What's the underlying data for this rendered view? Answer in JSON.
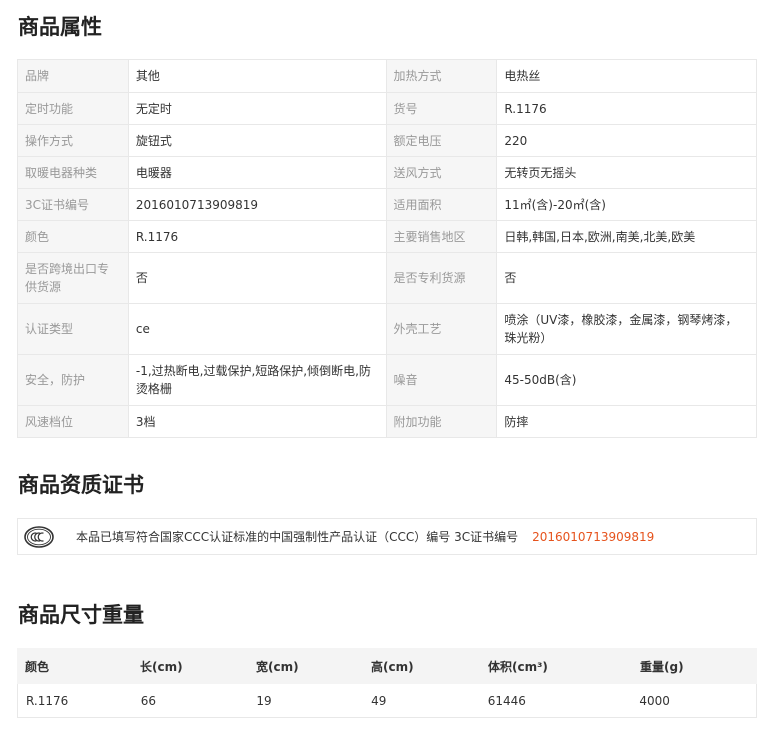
{
  "attributes": {
    "title": "商品属性",
    "rows": [
      {
        "l1": "品牌",
        "v1": "其他",
        "l2": "加热方式",
        "v2": "电热丝"
      },
      {
        "l1": "定时功能",
        "v1": "无定时",
        "l2": "货号",
        "v2": "R.1176"
      },
      {
        "l1": "操作方式",
        "v1": "旋钮式",
        "l2": "额定电压",
        "v2": "220"
      },
      {
        "l1": "取暖电器种类",
        "v1": "电暖器",
        "l2": "送风方式",
        "v2": "无转页无摇头"
      },
      {
        "l1": "3C证书编号",
        "v1": "2016010713909819",
        "l2": "适用面积",
        "v2": "11㎡(含)-20㎡(含)"
      },
      {
        "l1": "颜色",
        "v1": "R.1176",
        "l2": "主要销售地区",
        "v2": "日韩,韩国,日本,欧洲,南美,北美,欧美"
      },
      {
        "l1": "是否跨境出口专供货源",
        "v1": "否",
        "l2": "是否专利货源",
        "v2": "否"
      },
      {
        "l1": "认证类型",
        "v1": "ce",
        "l2": "外壳工艺",
        "v2": "喷涂（UV漆，橡胶漆，金属漆，钢琴烤漆，珠光粉）"
      },
      {
        "l1": "安全，防护",
        "v1": "-1,过热断电,过载保护,短路保护,倾倒断电,防烫格栅",
        "l2": "噪音",
        "v2": "45-50dB(含)"
      },
      {
        "l1": "风速档位",
        "v1": "3档",
        "l2": "附加功能",
        "v2": "防摔"
      }
    ]
  },
  "certificate": {
    "title": "商品资质证书",
    "icon": "ccc-logo-icon",
    "text": "本品已填写符合国家CCC认证标准的中国强制性产品认证（CCC）编号 3C证书编号",
    "number": "2016010713909819",
    "number_color": "#e6531d"
  },
  "dimensions": {
    "title": "商品尺寸重量",
    "headers": [
      "颜色",
      "长(cm)",
      "宽(cm)",
      "高(cm)",
      "体积(cm³)",
      "重量(g)"
    ],
    "rows": [
      [
        "R.1176",
        "66",
        "19",
        "49",
        "61446",
        "4000"
      ]
    ]
  }
}
